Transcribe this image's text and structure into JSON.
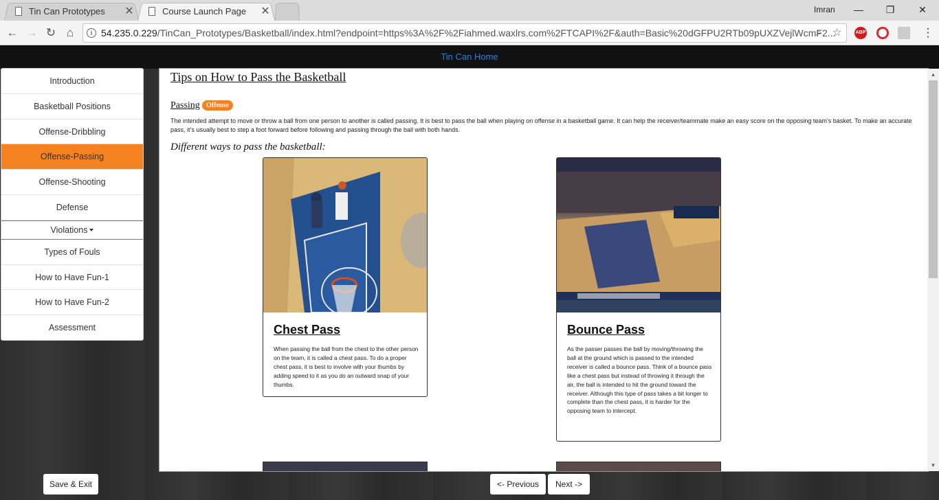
{
  "browser": {
    "tabs": [
      {
        "label": "Tin Can Prototypes"
      },
      {
        "label": "Course Launch Page"
      }
    ],
    "user": "Imran",
    "url_host": "54.235.0.229",
    "url_rest": "/TinCan_Prototypes/Basketball/index.html?endpoint=https%3A%2F%2Fiahmed.waxlrs.com%2FTCAPI%2F&auth=Basic%20dGFPU2RTb09pUXZVejlWcmF2...",
    "ext_abp": "ABP"
  },
  "topnav": {
    "home_link": "Tin Can Home"
  },
  "sidebar": {
    "items": [
      {
        "label": "Introduction"
      },
      {
        "label": "Basketball Positions"
      },
      {
        "label": "Offense-Dribbling"
      },
      {
        "label": "Offense-Passing"
      },
      {
        "label": "Offense-Shooting"
      },
      {
        "label": "Defense"
      },
      {
        "label": "Violations"
      },
      {
        "label": "Types of Fouls"
      },
      {
        "label": "How to Have Fun-1"
      },
      {
        "label": "How to Have Fun-2"
      },
      {
        "label": "Assessment"
      }
    ]
  },
  "main": {
    "title": "Tips on How to Pass the Basketball",
    "section": "Passing",
    "badge": "Offense",
    "intro": "The intended attempt to move or throw a ball from one person to another is called passing. It is best to pass the ball when playing on offense in a basketball game. It can help the receiver/teammate make an easy score on the opposing team’s basket. To make an accurate pass, it’s usually best to step a foot forward before following and passing through the ball with both hands.",
    "subhead": "Different ways to pass the basketball:",
    "cards": [
      {
        "title": "Chest Pass",
        "text": "When passing the ball from the chest to the other person on the team, it is called a chest pass. To do a proper chest pass, it is best to involve with your thumbs by adding speed to it as you do an outward snap of your thumbs."
      },
      {
        "title": "Bounce Pass",
        "text": "As the passer passes the ball by moving/throwing the ball at the ground which is passed to the intended receiver is called a bounce pass. Think of a bounce pass like a chest pass but instead of throwing it through the air, the ball is intended to hit the ground toward the receiver. Although this type of pass takes a bit longer to complete than the chest pass, it is harder for the opposing team to intercept."
      }
    ]
  },
  "footer": {
    "save_exit": "Save & Exit",
    "previous": "<- Previous",
    "next": "Next ->"
  },
  "colors": {
    "accent": "#f58220",
    "link": "#2f7fe0"
  }
}
